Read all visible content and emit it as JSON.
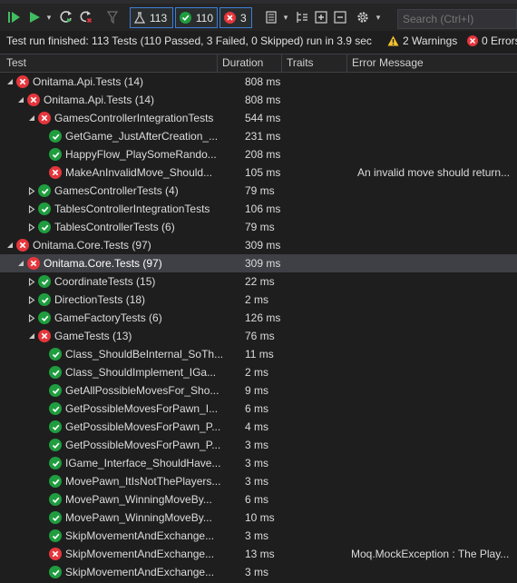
{
  "toolbar": {
    "run_all_icon": "run-all-icon",
    "run_icon": "run-icon",
    "repeat_icon": "repeat-last-run-icon",
    "cancel_icon": "cancel-icon",
    "filter_icon": "filter-icon",
    "total_count": "113",
    "passed_count": "110",
    "failed_count": "3",
    "search_placeholder": "Search (Ctrl+I)"
  },
  "status": {
    "summary": "Test run finished: 113 Tests (110 Passed, 3 Failed, 0 Skipped) run in 3.9 sec",
    "warnings": "2 Warnings",
    "errors": "0 Errors"
  },
  "columns": {
    "test": "Test",
    "duration": "Duration",
    "traits": "Traits",
    "error_message": "Error Message"
  },
  "rows": [
    {
      "name": "Onitama.Api.Tests (14)",
      "duration": "808 ms",
      "error": "",
      "status": "fail",
      "level": 0,
      "expander": "open"
    },
    {
      "name": "Onitama.Api.Tests (14)",
      "duration": "808 ms",
      "error": "",
      "status": "fail",
      "level": 1,
      "expander": "open"
    },
    {
      "name": "GamesControllerIntegrationTests",
      "duration": "544 ms",
      "error": "",
      "status": "fail",
      "level": 2,
      "expander": "open"
    },
    {
      "name": "GetGame_JustAfterCreation_...",
      "duration": "231 ms",
      "error": "",
      "status": "pass",
      "level": 3,
      "expander": ""
    },
    {
      "name": "HappyFlow_PlaySomeRando...",
      "duration": "208 ms",
      "error": "",
      "status": "pass",
      "level": 3,
      "expander": ""
    },
    {
      "name": "MakeAnInvalidMove_Should...",
      "duration": "105 ms",
      "error": "An invalid move should return...",
      "status": "fail",
      "level": 3,
      "expander": ""
    },
    {
      "name": "GamesControllerTests (4)",
      "duration": "79 ms",
      "error": "",
      "status": "pass",
      "level": 2,
      "expander": "closed"
    },
    {
      "name": "TablesControllerIntegrationTests",
      "duration": "106 ms",
      "error": "",
      "status": "pass",
      "level": 2,
      "expander": "closed"
    },
    {
      "name": "TablesControllerTests (6)",
      "duration": "79 ms",
      "error": "",
      "status": "pass",
      "level": 2,
      "expander": "closed"
    },
    {
      "name": "Onitama.Core.Tests (97)",
      "duration": "309 ms",
      "error": "",
      "status": "fail",
      "level": 0,
      "expander": "open"
    },
    {
      "name": "Onitama.Core.Tests (97)",
      "duration": "309 ms",
      "error": "",
      "status": "fail",
      "level": 1,
      "expander": "open",
      "selected": true
    },
    {
      "name": "CoordinateTests (15)",
      "duration": "22 ms",
      "error": "",
      "status": "pass",
      "level": 2,
      "expander": "closed"
    },
    {
      "name": "DirectionTests (18)",
      "duration": "2 ms",
      "error": "",
      "status": "pass",
      "level": 2,
      "expander": "closed"
    },
    {
      "name": "GameFactoryTests (6)",
      "duration": "126 ms",
      "error": "",
      "status": "pass",
      "level": 2,
      "expander": "closed"
    },
    {
      "name": "GameTests (13)",
      "duration": "76 ms",
      "error": "",
      "status": "fail",
      "level": 2,
      "expander": "open"
    },
    {
      "name": "Class_ShouldBeInternal_SoTh...",
      "duration": "11 ms",
      "error": "",
      "status": "pass",
      "level": 3,
      "expander": ""
    },
    {
      "name": "Class_ShouldImplement_IGa...",
      "duration": "2 ms",
      "error": "",
      "status": "pass",
      "level": 3,
      "expander": ""
    },
    {
      "name": "GetAllPossibleMovesFor_Sho...",
      "duration": "9 ms",
      "error": "",
      "status": "pass",
      "level": 3,
      "expander": ""
    },
    {
      "name": "GetPossibleMovesForPawn_I...",
      "duration": "6 ms",
      "error": "",
      "status": "pass",
      "level": 3,
      "expander": ""
    },
    {
      "name": "GetPossibleMovesForPawn_P...",
      "duration": "4 ms",
      "error": "",
      "status": "pass",
      "level": 3,
      "expander": ""
    },
    {
      "name": "GetPossibleMovesForPawn_P...",
      "duration": "3 ms",
      "error": "",
      "status": "pass",
      "level": 3,
      "expander": ""
    },
    {
      "name": "IGame_Interface_ShouldHave...",
      "duration": "3 ms",
      "error": "",
      "status": "pass",
      "level": 3,
      "expander": ""
    },
    {
      "name": "MovePawn_ItIsNotThePlayers...",
      "duration": "3 ms",
      "error": "",
      "status": "pass",
      "level": 3,
      "expander": ""
    },
    {
      "name": "MovePawn_WinningMoveBy...",
      "duration": "6 ms",
      "error": "",
      "status": "pass",
      "level": 3,
      "expander": ""
    },
    {
      "name": "MovePawn_WinningMoveBy...",
      "duration": "10 ms",
      "error": "",
      "status": "pass",
      "level": 3,
      "expander": ""
    },
    {
      "name": "SkipMovementAndExchange...",
      "duration": "3 ms",
      "error": "",
      "status": "pass",
      "level": 3,
      "expander": ""
    },
    {
      "name": "SkipMovementAndExchange...",
      "duration": "13 ms",
      "error": "Moq.MockException : The Play...",
      "status": "fail",
      "level": 3,
      "expander": ""
    },
    {
      "name": "SkipMovementAndExchange...",
      "duration": "3 ms",
      "error": "",
      "status": "pass",
      "level": 3,
      "expander": ""
    }
  ],
  "colors": {
    "pass": "#1f9d3f",
    "fail": "#e5363c",
    "warning": "#f2c12e",
    "accent": "#3c7fd6"
  }
}
